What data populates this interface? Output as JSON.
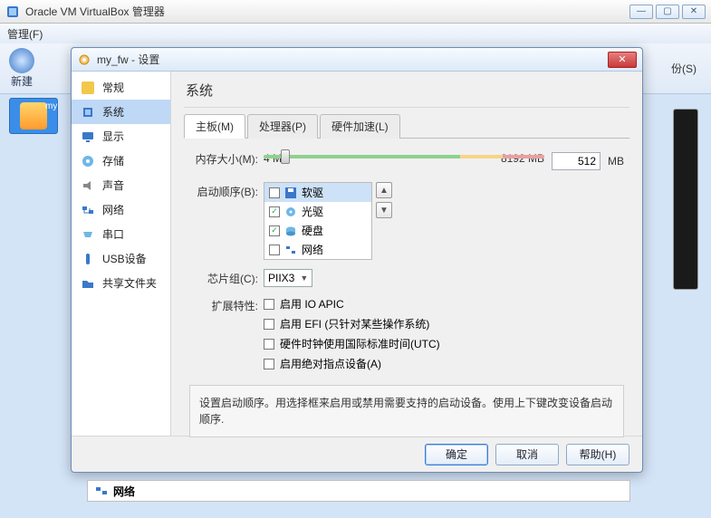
{
  "main": {
    "title": "Oracle VM VirtualBox 管理器",
    "menu": [
      "管理(F)"
    ],
    "toolbar": {
      "new_label": "新建"
    },
    "right_label": "份(S)",
    "vm_abbrev": "my",
    "bottom_peek": "网络"
  },
  "dialog": {
    "title": "my_fw - 设置",
    "sidebar": [
      {
        "label": "常规"
      },
      {
        "label": "系统"
      },
      {
        "label": "显示"
      },
      {
        "label": "存储"
      },
      {
        "label": "声音"
      },
      {
        "label": "网络"
      },
      {
        "label": "串口"
      },
      {
        "label": "USB设备"
      },
      {
        "label": "共享文件夹"
      }
    ],
    "section_title": "系统",
    "tabs": [
      {
        "label": "主板(M)"
      },
      {
        "label": "处理器(P)"
      },
      {
        "label": "硬件加速(L)"
      }
    ],
    "memory": {
      "label": "内存大小(M):",
      "min": "4",
      "max": "8192",
      "unit_min": "MB",
      "unit_max": "MB",
      "value": "512",
      "unit": "MB"
    },
    "boot": {
      "label": "启动顺序(B):",
      "items": [
        {
          "checked": false,
          "name": "软驱",
          "icon": "floppy"
        },
        {
          "checked": true,
          "name": "光驱",
          "icon": "optical"
        },
        {
          "checked": true,
          "name": "硬盘",
          "icon": "hdd"
        },
        {
          "checked": false,
          "name": "网络",
          "icon": "net"
        }
      ]
    },
    "chipset": {
      "label": "芯片组(C):",
      "value": "PIIX3"
    },
    "extended": {
      "label": "扩展特性:",
      "opts": [
        "启用 IO APIC",
        "启用 EFI (只针对某些操作系统)",
        "硬件时钟使用国际标准时间(UTC)",
        "启用绝对指点设备(A)"
      ]
    },
    "help_text": "设置启动顺序。用选择框来启用或禁用需要支持的启动设备。使用上下键改变设备启动顺序.",
    "buttons": {
      "ok": "确定",
      "cancel": "取消",
      "help": "帮助(H)"
    }
  }
}
